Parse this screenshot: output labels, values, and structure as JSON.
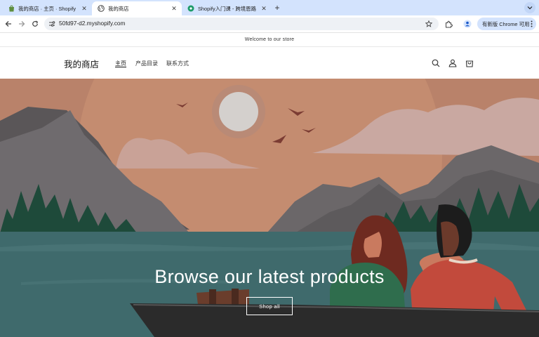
{
  "browser": {
    "tabs": [
      {
        "title": "我的商店 · 主页 · Shopify",
        "favicon": "shopify-bag-icon"
      },
      {
        "title": "我的商店",
        "favicon": "globe-icon"
      },
      {
        "title": "Shopify入门课 - 跨境恩路",
        "favicon": "green-circle-icon"
      }
    ],
    "active_tab": 1,
    "url": "50fd97-d2.myshopify.com",
    "update_label": "有新版 Chrome 可用"
  },
  "store": {
    "announcement": "Welcome to our store",
    "name": "我的商店",
    "nav": [
      "主页",
      "产品目录",
      "联系方式"
    ],
    "active_nav": 0,
    "header_icons": [
      "search-icon",
      "account-icon",
      "cart-icon"
    ],
    "hero": {
      "title": "Browse our latest products",
      "button_label": "Shop all"
    }
  },
  "colors": {
    "tabstrip": "#d3e3fd",
    "sky": "#b9826a",
    "water": "#3f6a6c",
    "boat": "#2b2b2b"
  }
}
